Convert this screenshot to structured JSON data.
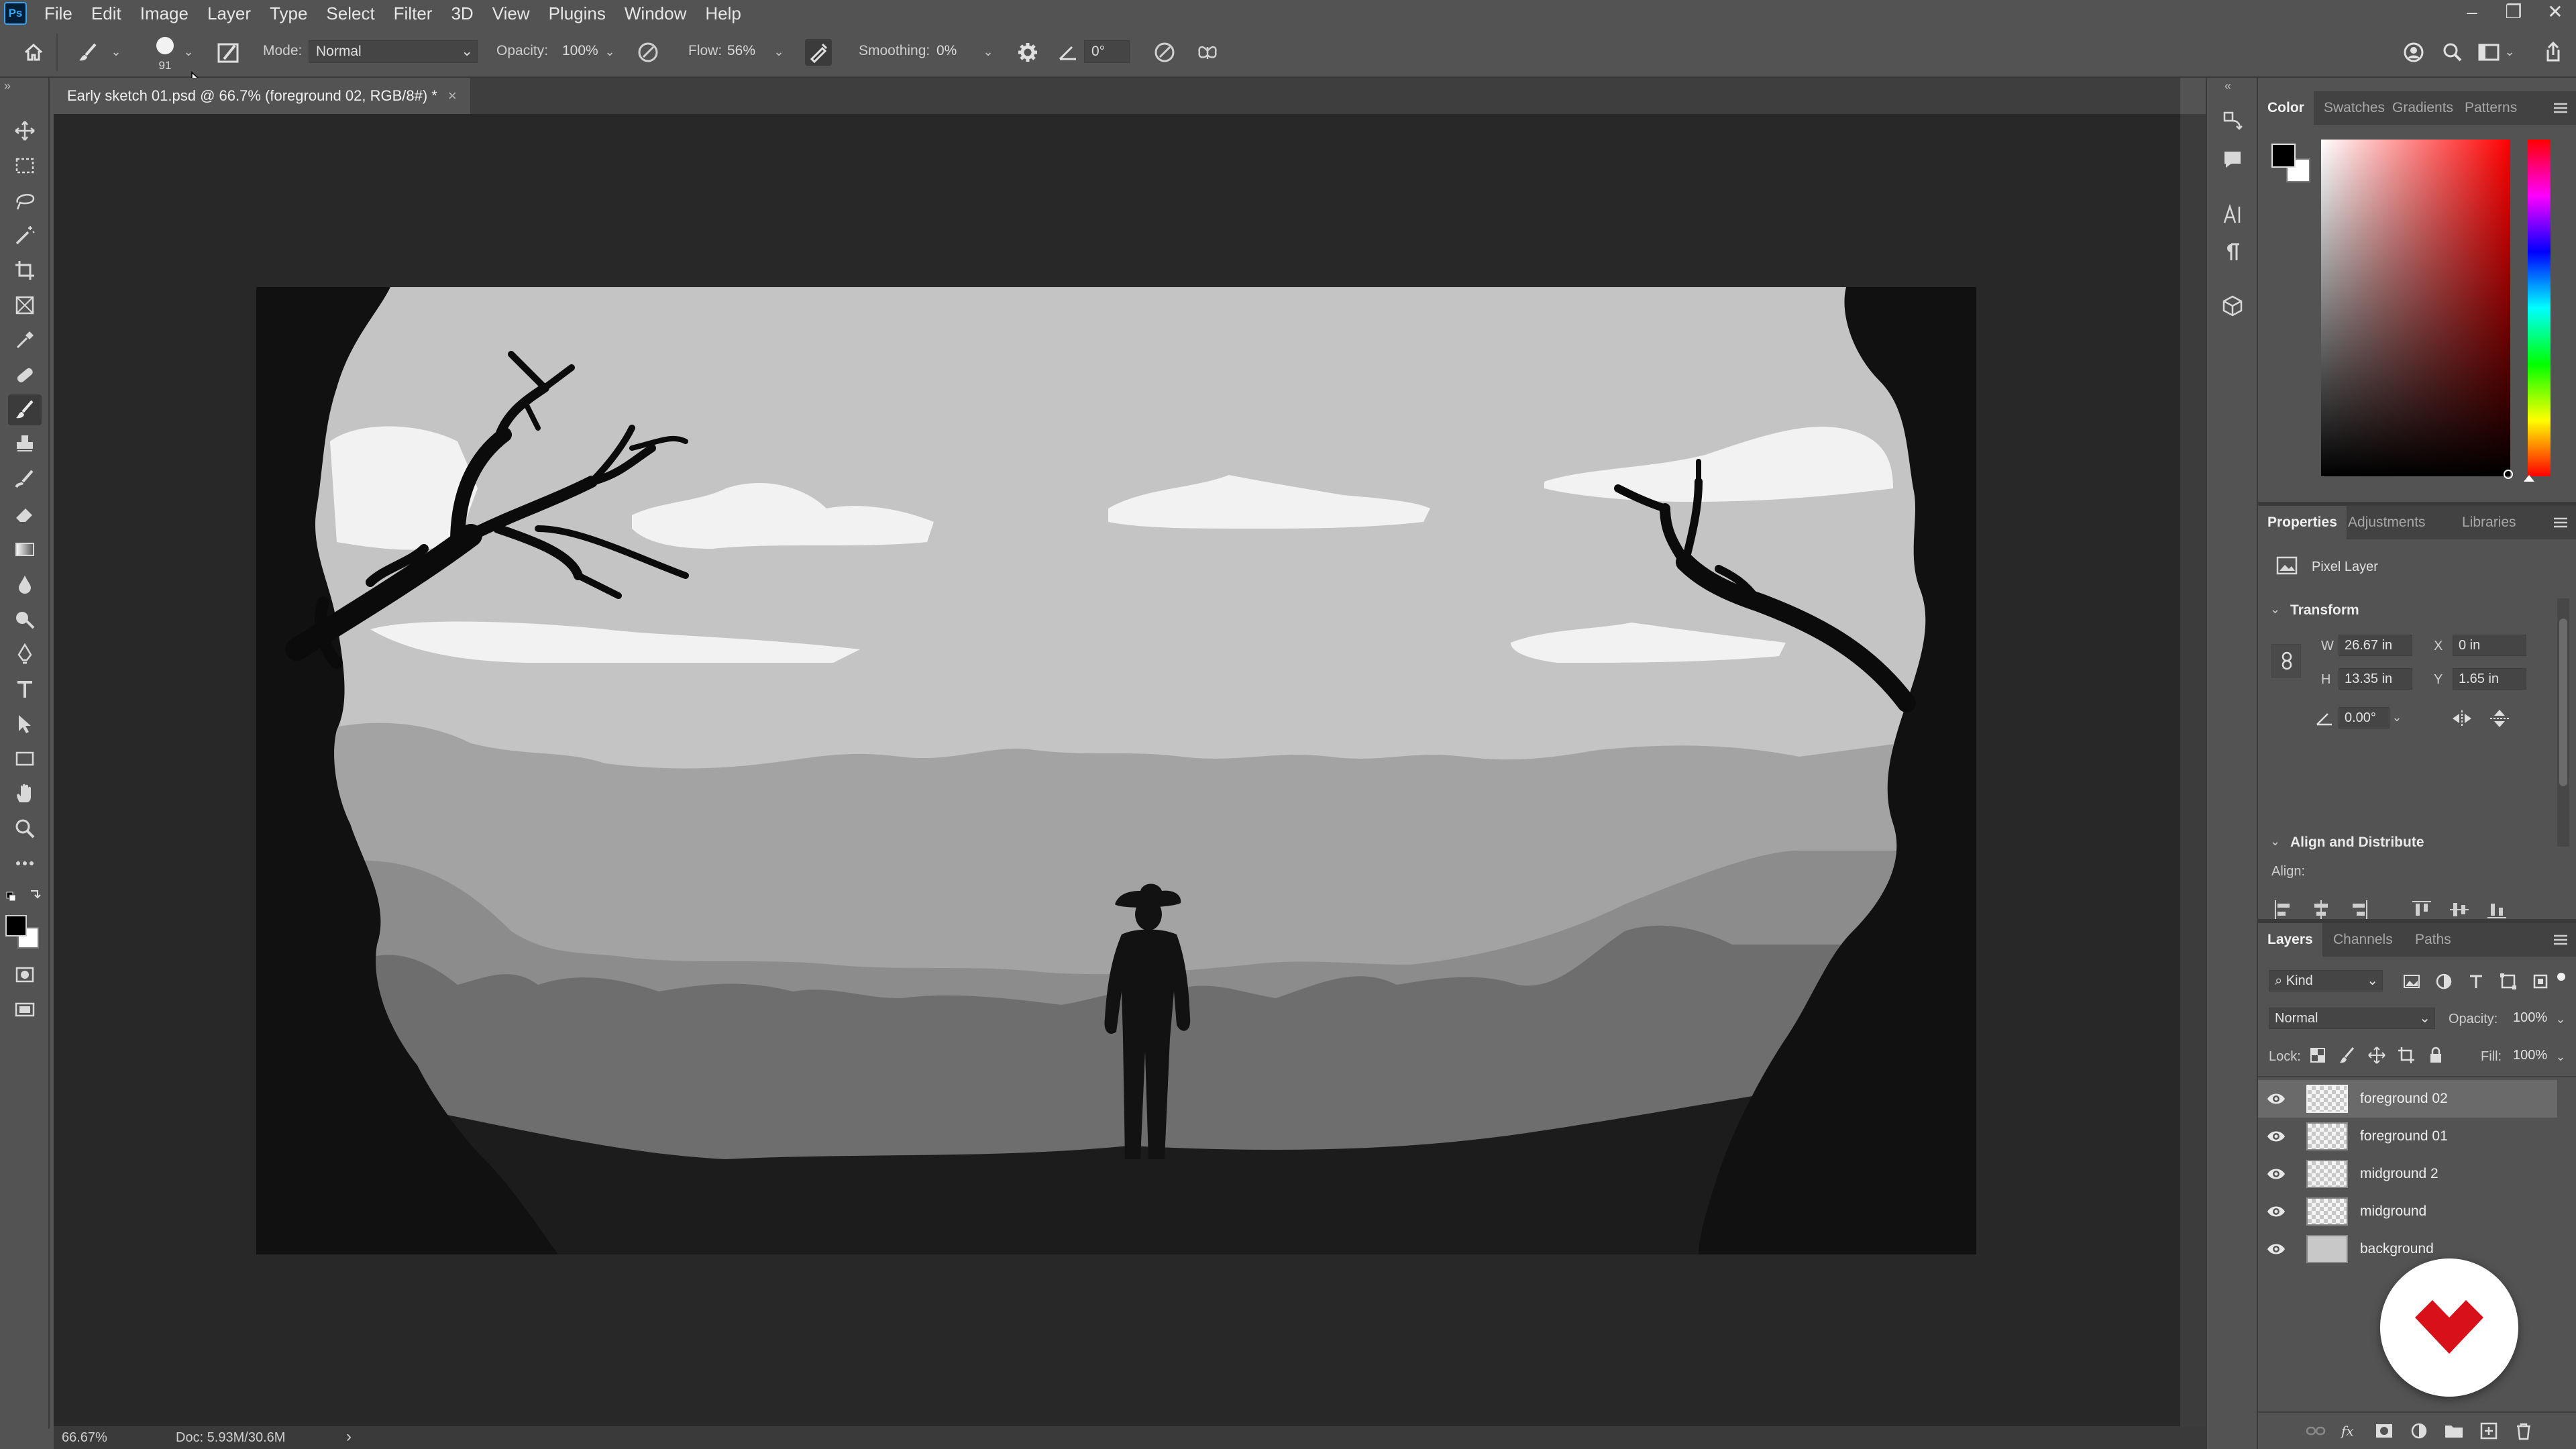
{
  "app": {
    "logo_label": "Ps",
    "menus": [
      "File",
      "Edit",
      "Image",
      "Layer",
      "Type",
      "Select",
      "Filter",
      "3D",
      "View",
      "Plugins",
      "Window",
      "Help"
    ],
    "window_controls": [
      "–",
      "❐",
      "✕"
    ]
  },
  "options": {
    "brush_size": "91",
    "mode_label": "Mode:",
    "mode_value": "Normal",
    "opacity_label": "Opacity:",
    "opacity_value": "100%",
    "flow_label": "Flow:",
    "flow_value": "56%",
    "smoothing_label": "Smoothing:",
    "smoothing_value": "0%",
    "angle_value": "0°"
  },
  "document": {
    "tab_title": "Early sketch 01.psd @ 66.7% (foreground 02, RGB/8#) *",
    "close_label": "×"
  },
  "status": {
    "zoom": "66.67%",
    "doc_size": "Doc: 5.93M/30.6M",
    "arrow": "›"
  },
  "color_panel": {
    "tabs": [
      "Color",
      "Swatches",
      "Gradients",
      "Patterns"
    ],
    "foreground": "#000000",
    "background": "#ffffff",
    "hue_base": "#ff0000"
  },
  "properties_panel": {
    "tabs": [
      "Properties",
      "Adjustments",
      "Libraries"
    ],
    "layer_kind": "Pixel Layer",
    "transform_title": "Transform",
    "w_label": "W",
    "w_value": "26.67 in",
    "h_label": "H",
    "h_value": "13.35 in",
    "x_label": "X",
    "x_value": "0 in",
    "y_label": "Y",
    "y_value": "1.65 in",
    "angle_value": "0.00°",
    "align_title": "Align and Distribute",
    "align_label": "Align:",
    "more": "..."
  },
  "layers_panel": {
    "tabs": [
      "Layers",
      "Channels",
      "Paths"
    ],
    "filter_kind": "Kind",
    "blend_mode": "Normal",
    "opacity_label": "Opacity:",
    "opacity_value": "100%",
    "lock_label": "Lock:",
    "fill_label": "Fill:",
    "fill_value": "100%",
    "layers": [
      {
        "name": "foreground 02",
        "selected": true,
        "visible": true
      },
      {
        "name": "foreground 01",
        "selected": false,
        "visible": true
      },
      {
        "name": "midground 2",
        "selected": false,
        "visible": true
      },
      {
        "name": "midground",
        "selected": false,
        "visible": true
      },
      {
        "name": "background",
        "selected": false,
        "visible": true
      }
    ]
  },
  "colors": {
    "badge_red": "#d7101a"
  }
}
